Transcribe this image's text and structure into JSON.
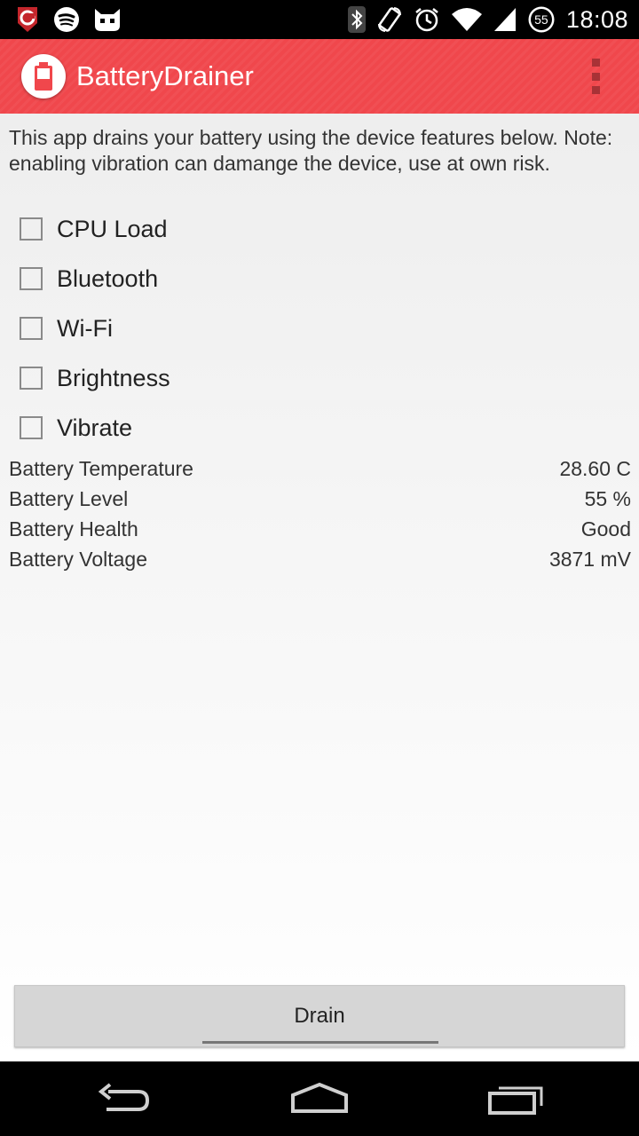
{
  "status_bar": {
    "time": "18:08",
    "battery_percent": "55",
    "left_icons": [
      "app-shield-icon",
      "spotify-icon",
      "cyanogen-mascot-icon"
    ],
    "right_icons": [
      "bluetooth-icon",
      "screen-rotation-icon",
      "alarm-icon",
      "wifi-icon",
      "cell-signal-icon",
      "battery-icon"
    ]
  },
  "action_bar": {
    "title": "BatteryDrainer",
    "color": "#f0474c",
    "menu_icon": "overflow-menu-icon"
  },
  "description": "This app drains your battery using the device features below. Note: enabling vibration can damange the device, use at own risk.",
  "features": [
    {
      "label": "CPU Load",
      "checked": false
    },
    {
      "label": "Bluetooth",
      "checked": false
    },
    {
      "label": "Wi-Fi",
      "checked": false
    },
    {
      "label": "Brightness",
      "checked": false
    },
    {
      "label": "Vibrate",
      "checked": false
    }
  ],
  "battery_info": [
    {
      "label": "Battery Temperature",
      "value": "28.60 C"
    },
    {
      "label": "Battery Level",
      "value": "55 %"
    },
    {
      "label": "Battery Health",
      "value": "Good"
    },
    {
      "label": "Battery Voltage",
      "value": "3871 mV"
    }
  ],
  "drain_button": {
    "label": "Drain"
  },
  "nav_bar": {
    "icons": [
      "back-icon",
      "home-icon",
      "recents-icon"
    ]
  }
}
